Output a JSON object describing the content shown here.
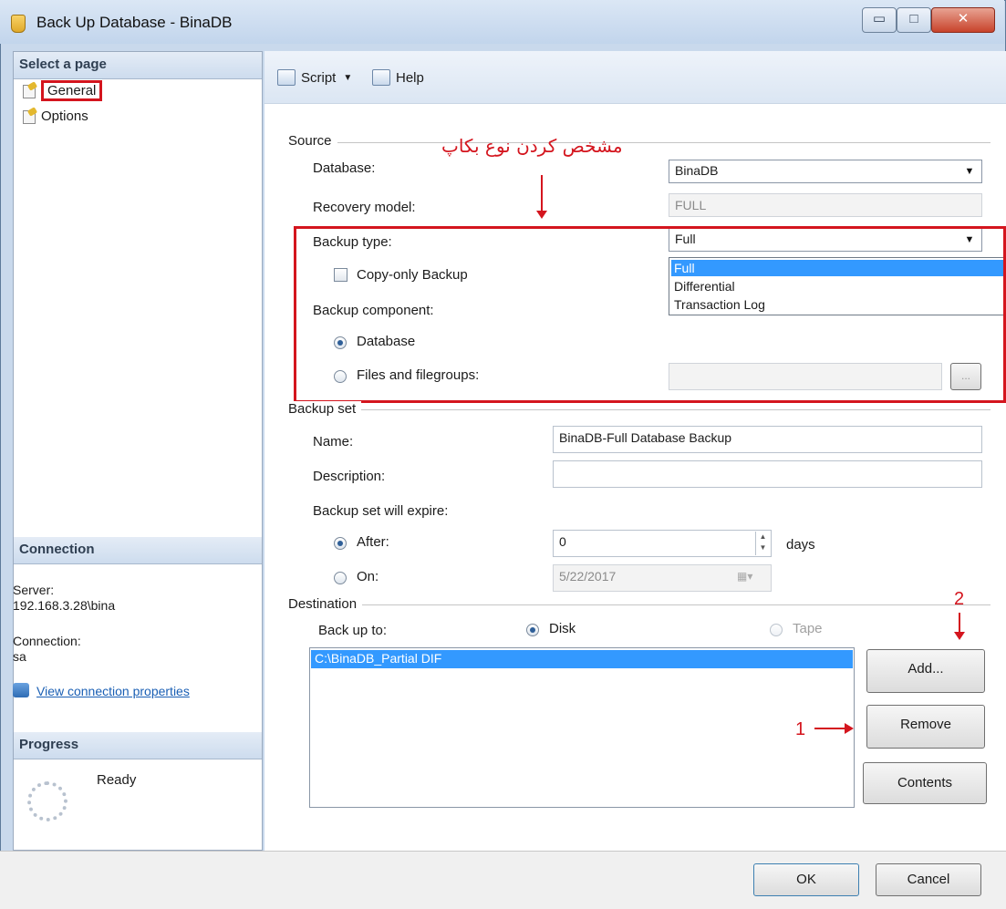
{
  "window": {
    "title": "Back Up Database - BinaDB",
    "minimize_glyph": "▭",
    "maximize_glyph": "□",
    "close_glyph": "✕"
  },
  "sidebar": {
    "select_page_header": "Select a page",
    "pages": [
      {
        "label": "General",
        "icon": "page-settings-icon",
        "highlighted": true
      },
      {
        "label": "Options",
        "icon": "page-settings-icon",
        "highlighted": false
      }
    ],
    "connection": {
      "header": "Connection",
      "server_label": "Server:",
      "server_value": "192.168.3.28\\bina",
      "connection_label": "Connection:",
      "connection_value": "sa",
      "view_link": "View connection properties"
    },
    "progress": {
      "header": "Progress",
      "status": "Ready"
    }
  },
  "toolbar": {
    "script_label": "Script",
    "script_dropdown_glyph": "▼",
    "help_label": "Help"
  },
  "source": {
    "group_label": "Source",
    "database_label": "Database:",
    "database_value": "BinaDB",
    "recovery_model_label": "Recovery model:",
    "recovery_model_value": "FULL",
    "backup_type_label": "Backup type:",
    "backup_type_value": "Full",
    "backup_type_options": [
      "Full",
      "Differential",
      "Transaction Log"
    ],
    "copy_only_label": "Copy-only Backup",
    "copy_only_checked": false,
    "backup_component_label": "Backup component:",
    "component_database_label": "Database",
    "component_files_label": "Files and filegroups:",
    "selected_component": "Database",
    "browse_glyph": "..."
  },
  "backup_set": {
    "group_label": "Backup set",
    "name_label": "Name:",
    "name_value": "BinaDB-Full Database Backup",
    "description_label": "Description:",
    "description_value": "",
    "expire_label": "Backup set will expire:",
    "after_label": "After:",
    "after_value": "0",
    "days_label": "days",
    "on_label": "On:",
    "on_value": "5/22/2017",
    "selected_expire": "After"
  },
  "destination": {
    "group_label": "Destination",
    "back_up_to_label": "Back up to:",
    "disk_label": "Disk",
    "tape_label": "Tape",
    "selected_target": "Disk",
    "paths": [
      "C:\\BinaDB_Partial DIF"
    ],
    "add_button": "Add...",
    "remove_button": "Remove",
    "contents_button": "Contents"
  },
  "footer": {
    "ok_button": "OK",
    "cancel_button": "Cancel"
  },
  "annotations": {
    "persian_note": "مشخص کردن نوع بکاپ",
    "marker_1": "1",
    "marker_2": "2",
    "color": "#d4151e"
  },
  "colors": {
    "selection": "#3399ff",
    "link": "#1a5fb4"
  }
}
